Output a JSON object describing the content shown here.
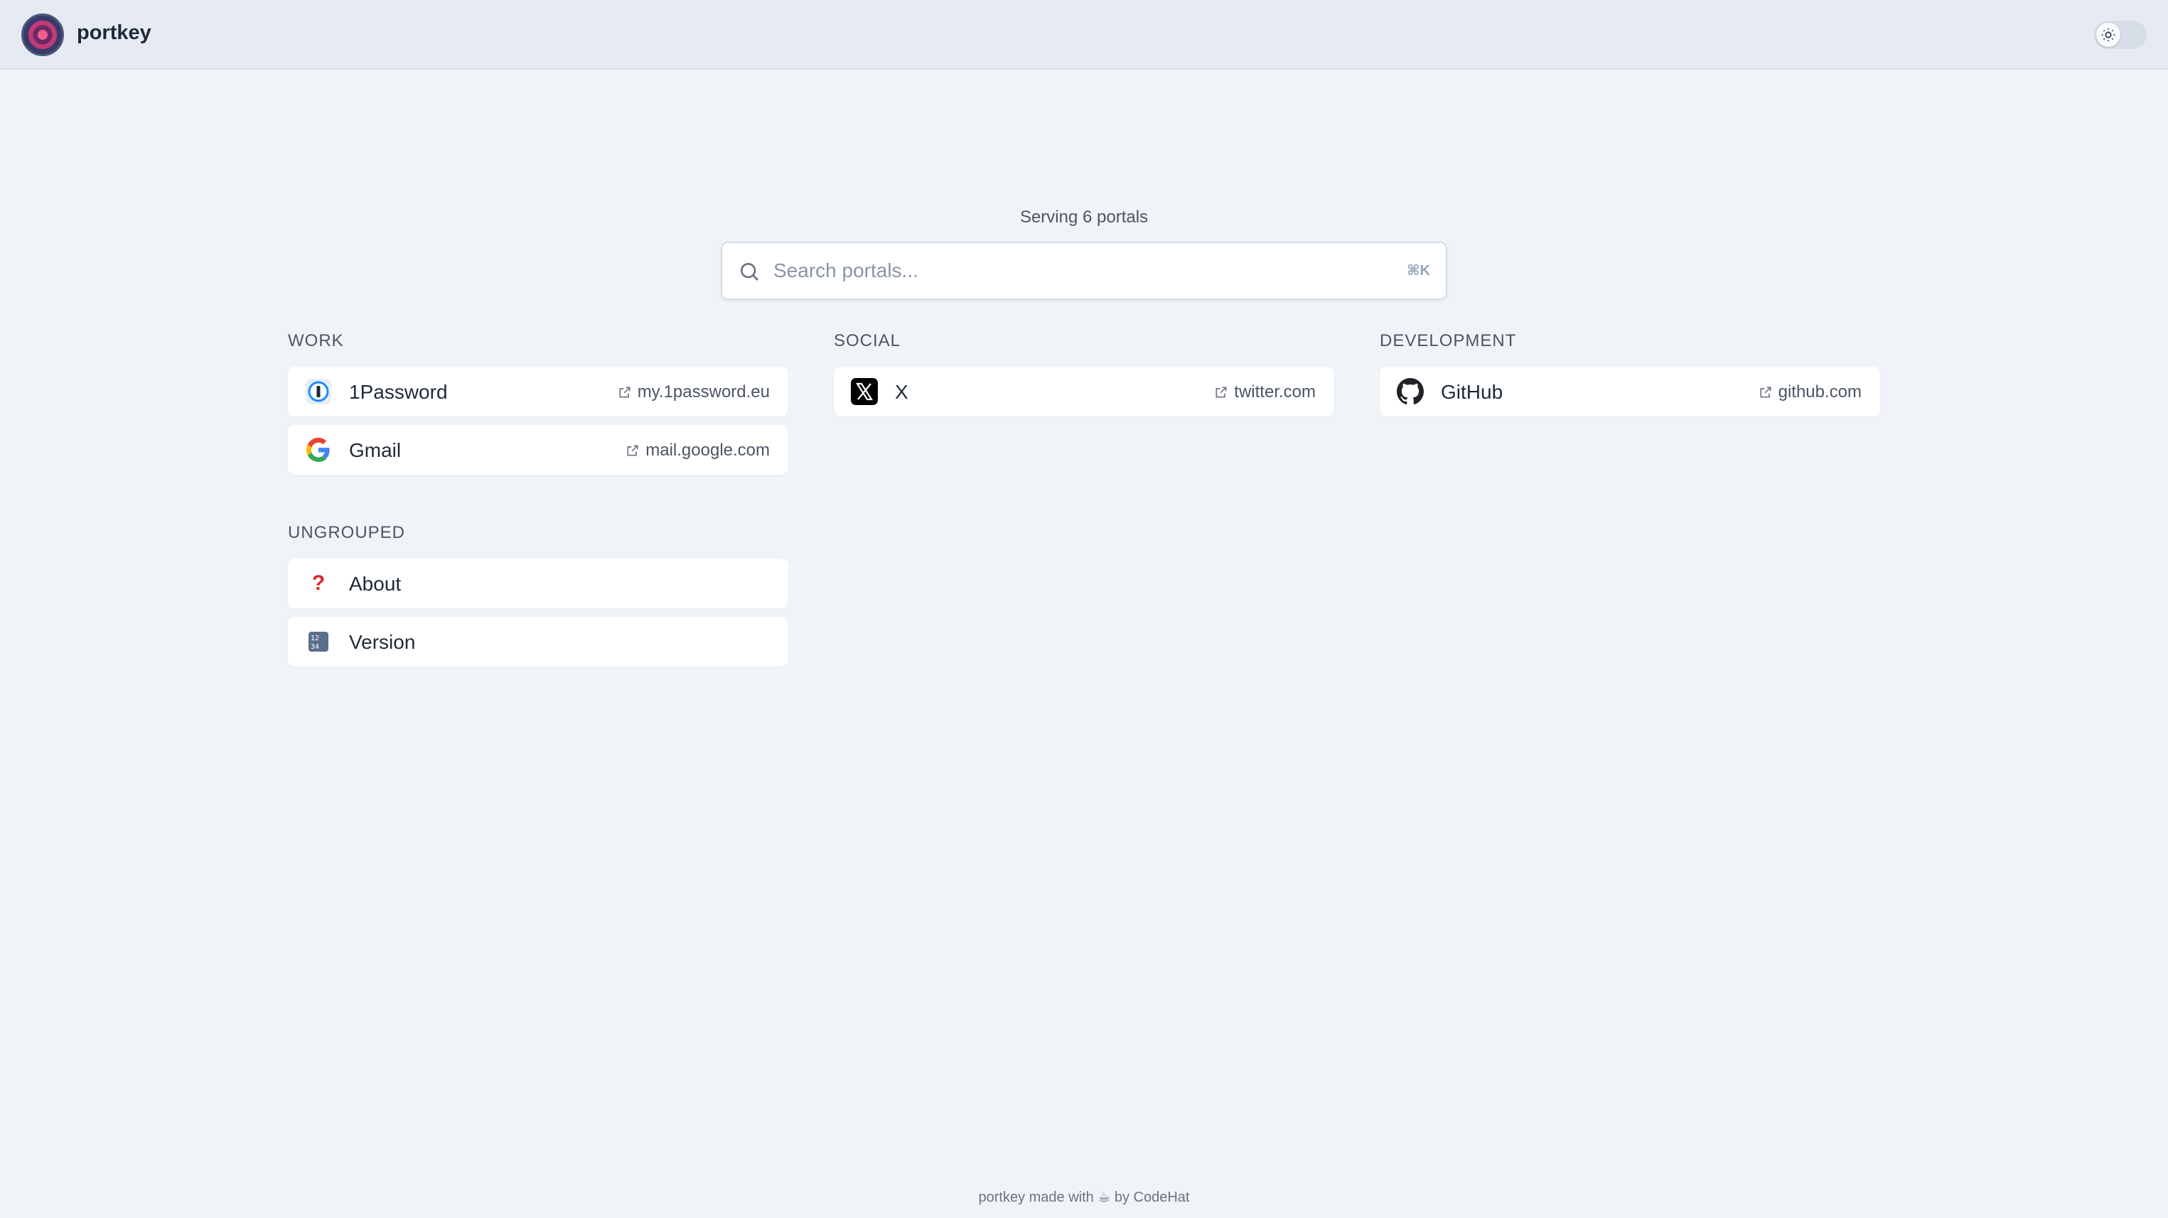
{
  "header": {
    "brand": "portkey"
  },
  "main": {
    "serving_text": "Serving 6 portals",
    "search": {
      "placeholder": "Search portals...",
      "shortcut": "⌘K"
    },
    "sections": {
      "work": {
        "title": "Work",
        "items": [
          {
            "name": "1Password",
            "link": "my.1password.eu",
            "icon": "1password-icon"
          },
          {
            "name": "Gmail",
            "link": "mail.google.com",
            "icon": "google-icon"
          }
        ]
      },
      "social": {
        "title": "Social",
        "items": [
          {
            "name": "X",
            "link": "twitter.com",
            "icon": "x-icon"
          }
        ]
      },
      "development": {
        "title": "Development",
        "items": [
          {
            "name": "GitHub",
            "link": "github.com",
            "icon": "github-icon"
          }
        ]
      },
      "ungrouped": {
        "title": "Ungrouped",
        "items": [
          {
            "name": "About",
            "icon": "question-icon"
          },
          {
            "name": "Version",
            "icon": "numbers-icon"
          }
        ]
      }
    }
  },
  "footer": {
    "text_before": "portkey made with",
    "text_after": "by CodeHat"
  },
  "colors": {
    "background": "#f0f4f9",
    "header": "#e6ebf3",
    "card": "#ffffff"
  }
}
